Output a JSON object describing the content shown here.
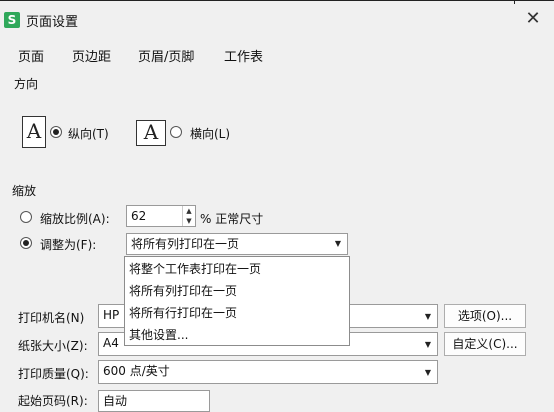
{
  "window": {
    "title": "页面设置",
    "app_icon": "S"
  },
  "tabs": [
    "页面",
    "页边距",
    "页眉/页脚",
    "工作表"
  ],
  "orientation": {
    "label": "方向",
    "portrait": {
      "glyph": "A",
      "label": "纵向(T)"
    },
    "landscape": {
      "glyph": "A",
      "label": "横向(L)"
    }
  },
  "scaling": {
    "label": "缩放",
    "ratio": {
      "label": "缩放比例(A):",
      "value": "62",
      "suffix": "% 正常尺寸"
    },
    "fit": {
      "label": "调整为(F):",
      "selected": "将所有列打印在一页"
    },
    "options": [
      "将整个工作表打印在一页",
      "将所有列打印在一页",
      "将所有行打印在一页",
      "其他设置..."
    ]
  },
  "printer": {
    "label": "打印机名(N)",
    "value": "HP",
    "button": "选项(O)..."
  },
  "paper": {
    "label": "纸张大小(Z):",
    "value": "A4",
    "button": "自定义(C)..."
  },
  "quality": {
    "label": "打印质量(Q):",
    "value": "600 点/英寸"
  },
  "start_page": {
    "label": "起始页码(R):",
    "value": "自动"
  }
}
